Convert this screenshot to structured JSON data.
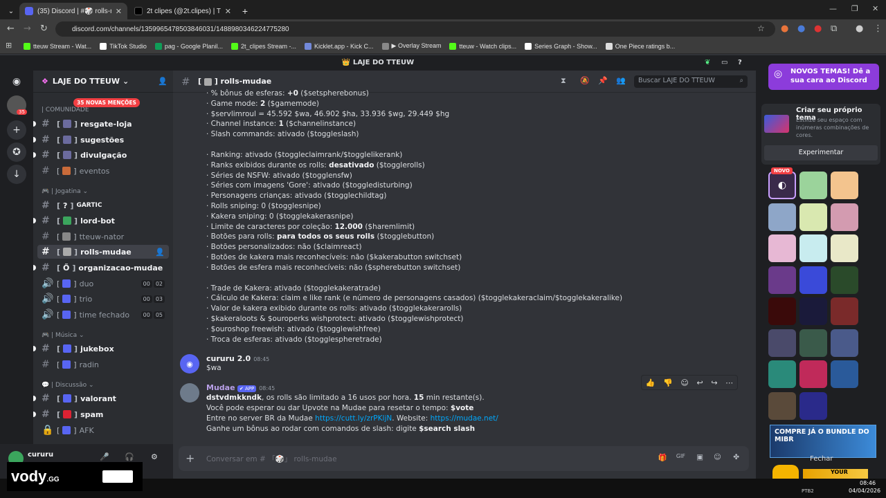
{
  "browser": {
    "tabs": [
      {
        "title": "(35) Discord | #🎲 rolls-muda"
      },
      {
        "title": "2t clipes (@2t.clipes) | TikTok"
      }
    ],
    "new_tab": "+",
    "url": "discord.com/channels/1359965478503846031/1488980346224775280",
    "bookmarks": [
      {
        "label": "tteuw Stream - Wat...",
        "color": "#53fc18"
      },
      {
        "label": "TikTok Studio",
        "color": "#ffffff"
      },
      {
        "label": "pag - Google Planil...",
        "color": "#0f9d58"
      },
      {
        "label": "2t_clipes Stream -...",
        "color": "#53fc18"
      },
      {
        "label": "Kicklet.app - Kick C...",
        "color": "#7289da"
      },
      {
        "label": "▶ Overlay Stream",
        "color": "#888888"
      },
      {
        "label": "tteuw - Watch clips...",
        "color": "#53fc18"
      },
      {
        "label": "Series Graph - Show...",
        "color": "#ffffff"
      },
      {
        "label": "One Piece ratings b...",
        "color": "#dddddd"
      }
    ]
  },
  "discord": {
    "top_title": "👑 LAJE DO TTEUW",
    "server_name": "LAJE DO TTEUW",
    "mentions_badge": "35 NOVAS MENÇÕES",
    "rail_badge": "35",
    "categories": {
      "comunidade": "| COMUNIDADE",
      "jogatina": "| Jogatina",
      "musica": "| Música",
      "discussao": "| Discussão"
    },
    "channels": [
      {
        "name": "resgate-loja"
      },
      {
        "name": "sugestões"
      },
      {
        "name": "divulgação"
      },
      {
        "name": "eventos"
      },
      {
        "name": "GARTIC"
      },
      {
        "name": "lord-bot"
      },
      {
        "name": "tteuw-nator"
      },
      {
        "name": "rolls-mudae"
      },
      {
        "name": "organizacao-mudae"
      },
      {
        "name": "duo",
        "c1": "00",
        "c2": "02"
      },
      {
        "name": "trio",
        "c1": "00",
        "c2": "03"
      },
      {
        "name": "time fechado",
        "c1": "00",
        "c2": "05"
      },
      {
        "name": "jukebox"
      },
      {
        "name": "radin"
      },
      {
        "name": "valorant"
      },
      {
        "name": "spam"
      },
      {
        "name": "AFK"
      }
    ],
    "user": {
      "name": "cururu"
    },
    "chat_channel": "rolls-mudae",
    "search_placeholder": "Buscar LAJE DO TTEUW",
    "composer_placeholder": "Conversar em # 「🎲」 rolls-mudae",
    "settings_lines": [
      "· % bônus de esferas: +0 ($setspherebonus)",
      "· Game mode: 2 ($gamemode)",
      "· $servlimroul = 45.592 $wa, 46.902 $ha, 33.936 $wg, 29.449 $hg",
      "· Channel instance: 1 ($channelinstance)",
      "· Slash commands: ativado ($toggleslash)",
      "",
      "· Ranking: ativado ($toggleclaimrank/$togglelikerank)",
      "· Ranks exibidos durante os rolls: desativado ($togglerolls)",
      "· Séries de NSFW: ativado ($togglensfw)",
      "· Séries com imagens 'Gore': ativado ($toggledisturbing)",
      "· Personagens crianças: ativado ($togglechildtag)",
      "· Rolls sniping: 0 ($togglesnipe)",
      "· Kakera sniping: 0 ($togglekakerasnipe)",
      "· Limite de caracteres por coleção: 12.000 ($haremlimit)",
      "· Botões para rolls: para todos os seus rolls ($togglebutton)",
      "· Botões personalizados: não ($claimreact)",
      "· Botões de kakera mais reconhecíveis: não ($kakerabutton switchset)",
      "· Botões de esfera mais reconhecíveis: não ($spherebutton switchset)",
      "",
      "· Trade de Kakera: ativado ($togglekakeratrade)",
      "· Cálculo de Kakera: claim e like rank (e número de personagens casados) ($togglekakeraclaim/$togglekakeralike)",
      "· Valor de kakera exibido durante os rolls: ativado ($togglekakerarolls)",
      "· $kakeraloots & $ouroperks wishprotect: ativado ($togglewishprotect)",
      "· $ouroshop freewish: ativado ($togglewishfree)",
      "· Troca de esferas: ativado ($togglespheretrade)"
    ],
    "msg1": {
      "author": "cururu 2.0",
      "time": "08:45",
      "text": "$wa"
    },
    "msg2": {
      "author": "Mudae",
      "app_badge": "✔ APP",
      "time": "08:45",
      "l1_user": "dstvdmkkndk",
      "l1_text": ", os rolls são limitado a 16 usos por hora. ",
      "l1_mins": "15",
      "l1_end": " min restante(s).",
      "l2_text": "Você pode esperar ou dar Upvote na Mudae para resetar o tempo: ",
      "l2_cmd": "$vote",
      "l3_a": "Entre no server BR da Mudae ",
      "l3_link1": "https://cutt.ly/zrPKljN",
      "l3_b": ". Website: ",
      "l3_link2": "https://mudae.net/",
      "l4_a": "Ganhe um bônus ao rodar com comandos de slash: digite ",
      "l4_cmd": "$search slash"
    }
  },
  "right_panel": {
    "promo": "NOVOS TEMAS! Dê a sua cara ao Discord",
    "theme_title": "Criar seu próprio tema",
    "theme_desc": "Estilize seu espaço com inúmeras combinações de cores.",
    "theme_button": "Experimentar",
    "novo_badge": "NOVO",
    "ad_text": "COMPRE JÁ O BUNDLE DO MIBR",
    "ad_close": "Fechar",
    "ad2_text": "YOUR"
  },
  "overlay": {
    "brand": "vody",
    "brand_suffix": ".GG"
  },
  "taskbar": {
    "time": "08:46",
    "date": "04/04/2026",
    "lang": "PTB2"
  }
}
